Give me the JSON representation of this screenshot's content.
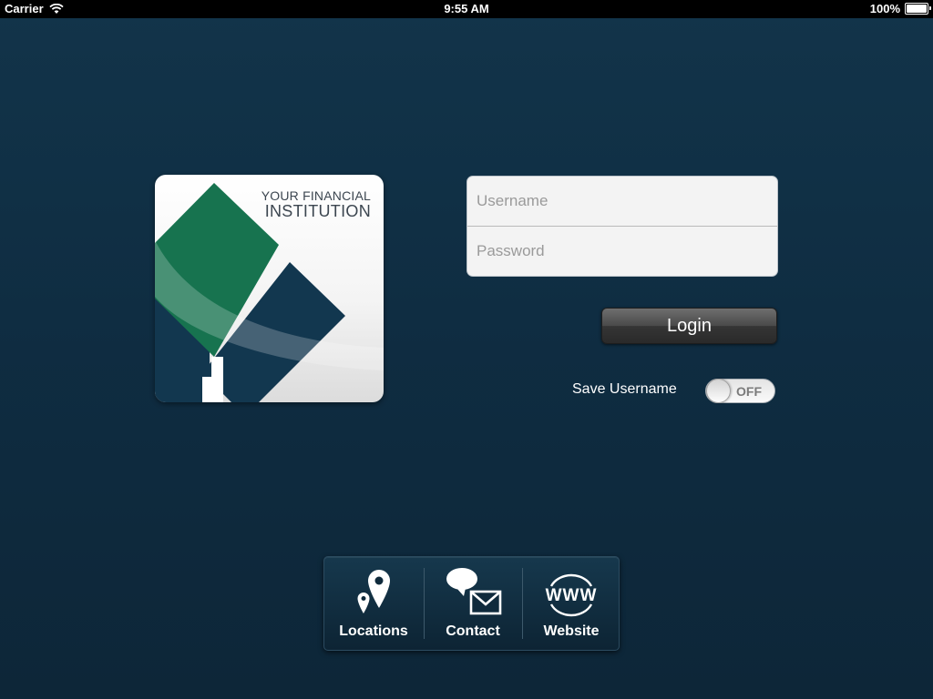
{
  "status_bar": {
    "carrier": "Carrier",
    "time": "9:55 AM",
    "battery": "100%",
    "battery_level": 1.0
  },
  "logo": {
    "line1": "YOUR FINANCIAL",
    "line2": "INSTITUTION",
    "colors": {
      "green": "#17734f",
      "navy": "#12374f",
      "light_green": "#3a9a79"
    }
  },
  "login": {
    "username_placeholder": "Username",
    "password_placeholder": "Password",
    "login_label": "Login",
    "save_username_label": "Save Username",
    "save_username_toggle": "OFF"
  },
  "toolbar": {
    "items": [
      {
        "label": "Locations",
        "icon": "location-pin-icon"
      },
      {
        "label": "Contact",
        "icon": "contact-chat-mail-icon"
      },
      {
        "label": "Website",
        "icon": "www-globe-icon"
      }
    ]
  }
}
